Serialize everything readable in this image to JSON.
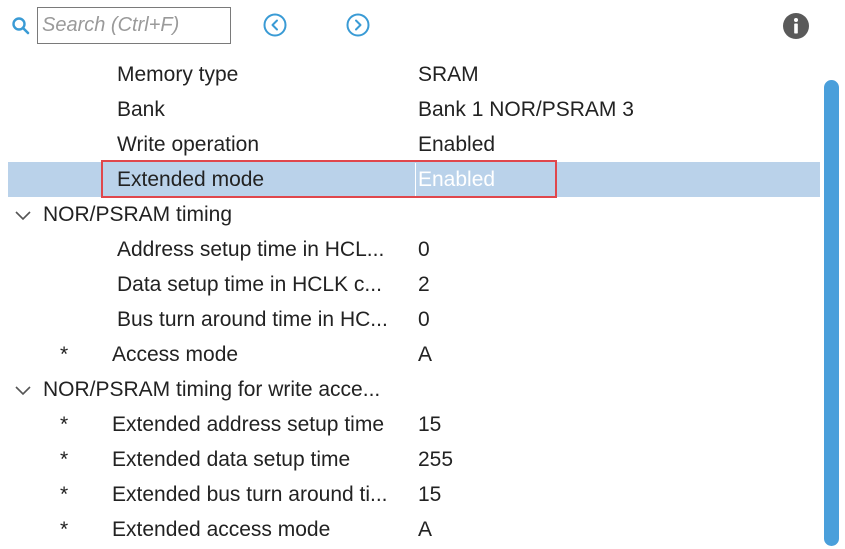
{
  "toolbar": {
    "search_placeholder": "Search (Ctrl+F)",
    "search_value": ""
  },
  "colors": {
    "accent": "#3a9bd5",
    "selected_row": "#bad2ea",
    "highlight_border": "#e0474c",
    "scrollbar_thumb": "#4a9fdb"
  },
  "rows": [
    {
      "kind": "prop",
      "star": "",
      "name": "Memory type",
      "value": "SRAM"
    },
    {
      "kind": "prop",
      "star": "",
      "name": "Bank",
      "value": "Bank 1 NOR/PSRAM 3"
    },
    {
      "kind": "prop",
      "star": "",
      "name": "Write operation",
      "value": "Enabled"
    },
    {
      "kind": "prop",
      "star": "",
      "name": "Extended mode",
      "value": "Enabled",
      "selected": true
    },
    {
      "kind": "group",
      "name": "NOR/PSRAM timing",
      "expanded": true
    },
    {
      "kind": "prop",
      "star": "",
      "name": "Address setup time in HCL...",
      "value": "0"
    },
    {
      "kind": "prop",
      "star": "",
      "name": "Data setup time in HCLK c...",
      "value": "2"
    },
    {
      "kind": "prop",
      "star": "",
      "name": "Bus turn around time in HC...",
      "value": "0"
    },
    {
      "kind": "prop",
      "star": "*",
      "name": "Access mode",
      "value": "A"
    },
    {
      "kind": "group",
      "name": "NOR/PSRAM timing for write acce...",
      "expanded": true
    },
    {
      "kind": "prop",
      "star": "*",
      "name": "Extended address setup time",
      "value": "15"
    },
    {
      "kind": "prop",
      "star": "*",
      "name": "Extended data setup time",
      "value": "255"
    },
    {
      "kind": "prop",
      "star": "*",
      "name": "Extended bus turn around ti...",
      "value": "15"
    },
    {
      "kind": "prop",
      "star": "*",
      "name": "Extended access mode",
      "value": "A"
    }
  ]
}
